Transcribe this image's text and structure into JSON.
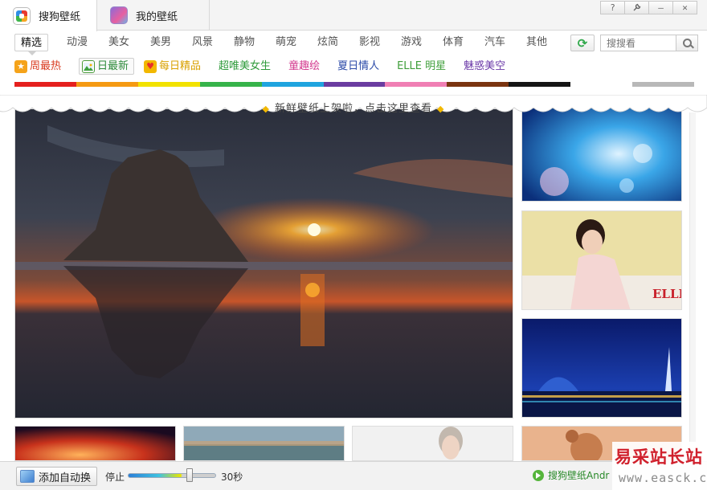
{
  "tabs": [
    {
      "label": "搜狗壁纸",
      "icon": "sogou-logo-icon",
      "active": true
    },
    {
      "label": "我的壁纸",
      "icon": "my-wallpaper-icon",
      "active": false
    }
  ],
  "window_buttons": {
    "help": "?",
    "settings": "⚙",
    "minimize": "—",
    "close": "✕"
  },
  "categories": [
    "精选",
    "动漫",
    "美女",
    "美男",
    "风景",
    "静物",
    "萌宠",
    "炫简",
    "影视",
    "游戏",
    "体育",
    "汽车",
    "其他"
  ],
  "active_category": "精选",
  "search": {
    "placeholder": "搜搜看"
  },
  "tags": [
    {
      "label": "周最热",
      "icon": "star-icon",
      "color": "#d93a1f"
    },
    {
      "label": "日最新",
      "icon": "picture-icon",
      "color": "#2d8a3a"
    },
    {
      "label": "每日精品",
      "icon": "heart-icon",
      "color": "#d9a100"
    },
    {
      "label": "超唯美女生",
      "icon": "",
      "color": "#2e9a3a"
    },
    {
      "label": "童趣绘",
      "icon": "",
      "color": "#d33b8f"
    },
    {
      "label": "夏日情人",
      "icon": "",
      "color": "#2b4aa8"
    },
    {
      "label": "ELLE 明星",
      "icon": "",
      "color": "#3f9e3a"
    },
    {
      "label": "魅惑美空",
      "icon": "",
      "color": "#6b3aa8"
    }
  ],
  "color_strip": [
    "#e5201e",
    "#f59a12",
    "#f2e200",
    "#36b34a",
    "#1fa4df",
    "#6a3ca0",
    "#f07fb4",
    "#7a3410",
    "#151515",
    "#ffffff",
    "#b8b8b8"
  ],
  "banner": {
    "text": "新鲜壁纸上架啦，点击这里查看"
  },
  "side_brand": "ELLE",
  "bottom": {
    "auto_button": "添加自动换",
    "stop_label": "停止",
    "interval": "30秒",
    "interval_fraction": 0.7,
    "android_label": "搜狗壁纸Andr"
  },
  "watermark": {
    "line1": "易采站长站",
    "line2": "www.easck.com"
  }
}
